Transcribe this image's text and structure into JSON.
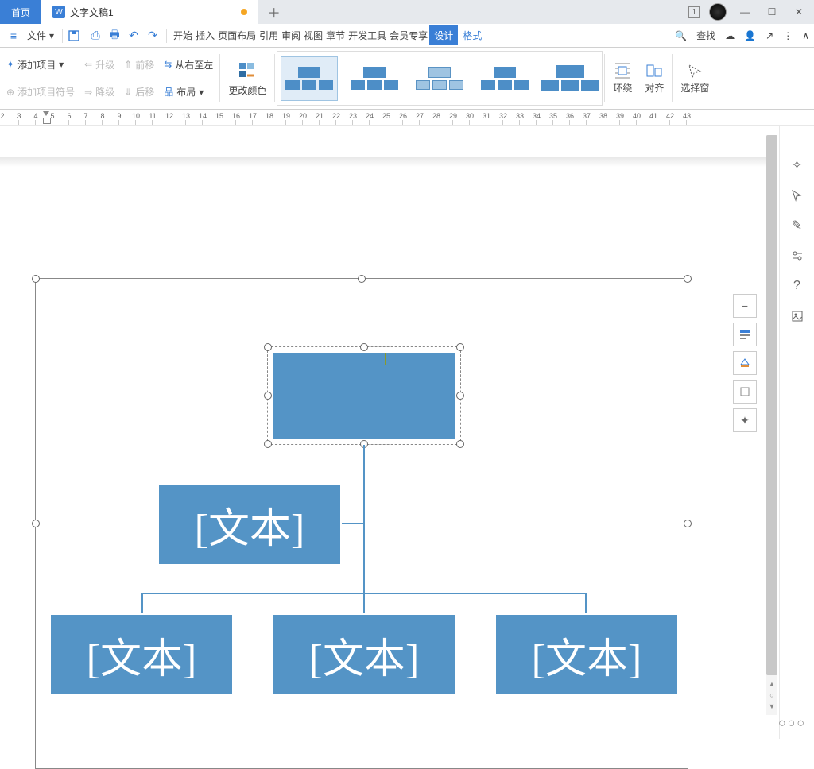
{
  "tabs": {
    "home": "首页",
    "doc": "文字文稿1",
    "win_badge": "1"
  },
  "menu": {
    "file": "文件",
    "items": [
      "开始",
      "插入",
      "页面布局",
      "引用",
      "审阅",
      "视图",
      "章节",
      "开发工具",
      "会员专享",
      "设计",
      "格式"
    ],
    "active_index": 9,
    "search": "查找"
  },
  "ribbon": {
    "add_item": "添加项目",
    "add_bullet": "添加项目符号",
    "promote": "升级",
    "demote": "降级",
    "move_fwd": "前移",
    "move_bwd": "后移",
    "rtl": "从右至左",
    "layout": "布局",
    "change_color": "更改颜色",
    "wrap": "环绕",
    "align": "对齐",
    "select_pane": "选择窗"
  },
  "ruler": {
    "start": 2,
    "end": 43,
    "marker_at": 3
  },
  "smartart": {
    "placeholder": "[文本]",
    "root_text": "",
    "assistant_text": "[文本]",
    "children": [
      "[文本]",
      "[文本]",
      "[文本]"
    ]
  },
  "colors": {
    "accent": "#3a7fd6",
    "node": "#5494c6"
  }
}
